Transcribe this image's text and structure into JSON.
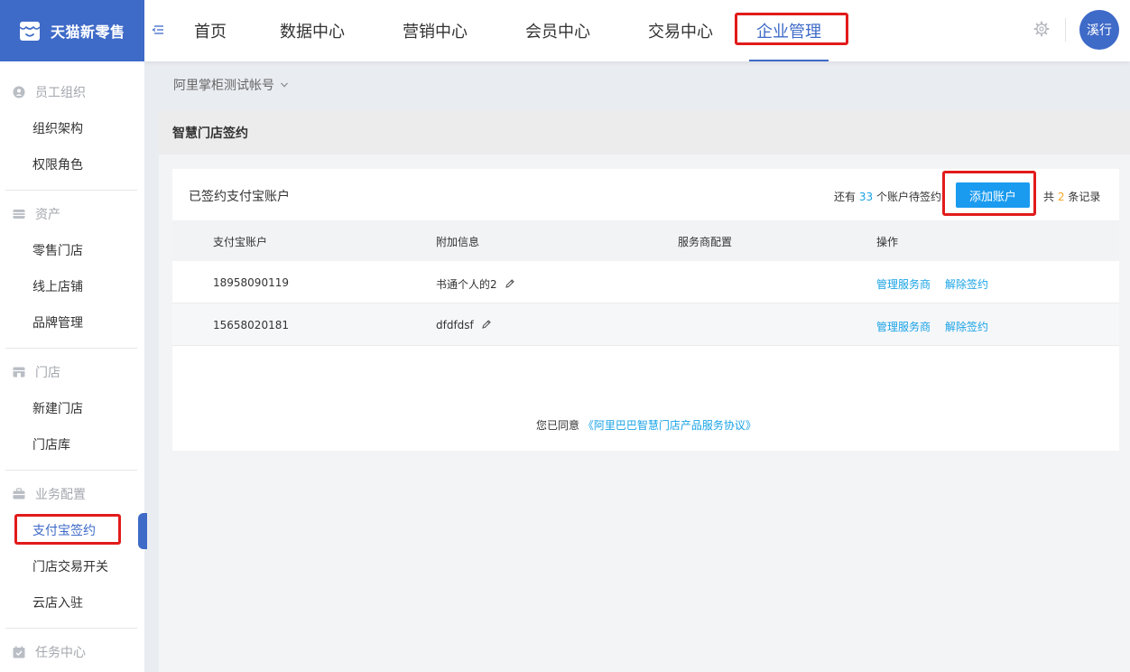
{
  "brand": {
    "name": "天猫新零售"
  },
  "nav": {
    "items": [
      {
        "label": "首页"
      },
      {
        "label": "数据中心"
      },
      {
        "label": "营销中心"
      },
      {
        "label": "会员中心"
      },
      {
        "label": "交易中心"
      },
      {
        "label": "企业管理",
        "active": true
      }
    ]
  },
  "user": {
    "avatar_text": "溪行"
  },
  "sidebar": {
    "sections": [
      {
        "title": "员工组织",
        "icon": "staff-icon",
        "items": [
          "组织架构",
          "权限角色"
        ]
      },
      {
        "title": "资产",
        "icon": "asset-icon",
        "items": [
          "零售门店",
          "线上店铺",
          "品牌管理"
        ]
      },
      {
        "title": "门店",
        "icon": "store-icon",
        "items": [
          "新建门店",
          "门店库"
        ]
      },
      {
        "title": "业务配置",
        "icon": "briefcase-icon",
        "items": [
          "支付宝签约",
          "门店交易开关",
          "云店入驻"
        ],
        "active_index": 0
      },
      {
        "title": "任务中心",
        "icon": "task-icon",
        "items": []
      }
    ]
  },
  "account": {
    "name": "阿里掌柜测试帐号"
  },
  "page": {
    "title": "智慧门店签约"
  },
  "card": {
    "title": "已签约支付宝账户",
    "pending_prefix": "还有",
    "pending_count": "33",
    "pending_suffix": "个账户待签约",
    "add_button": "添加账户",
    "total_prefix": "共",
    "total_count": "2",
    "total_suffix": "条记录"
  },
  "table": {
    "headers": [
      "支付宝账户",
      "附加信息",
      "服务商配置",
      "操作"
    ],
    "rows": [
      {
        "account": "18958090119",
        "info": "书通个人的2",
        "provider": "",
        "actions": [
          "管理服务商",
          "解除签约"
        ]
      },
      {
        "account": "15658020181",
        "info": "dfdfdsf",
        "provider": "",
        "actions": [
          "管理服务商",
          "解除签约"
        ]
      }
    ]
  },
  "agreement": {
    "prefix": "您已同意",
    "link": "《阿里巴巴智慧门店产品服务协议》"
  },
  "colors": {
    "primary": "#3e6ac8",
    "link": "#19a3e6",
    "button": "#1a9bf0",
    "highlight": "#e21b1b",
    "count_orange": "#f5a623"
  }
}
